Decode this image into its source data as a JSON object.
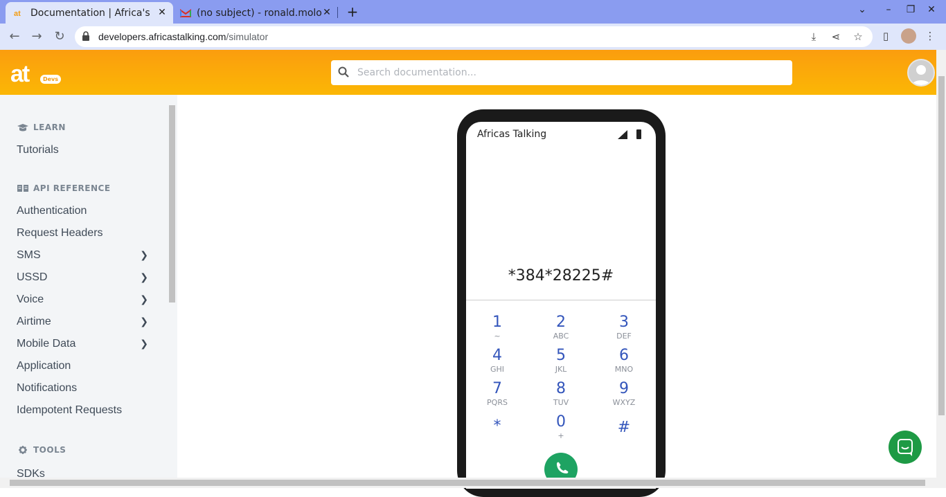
{
  "browser": {
    "tabs": [
      {
        "title": "Documentation | Africa's",
        "icon": "at-favicon"
      },
      {
        "title": "(no subject) - ronald.molo",
        "icon": "gmail-favicon"
      }
    ],
    "new_tab": "+",
    "url_host": "developers.africastalking.com",
    "url_path": "/simulator"
  },
  "header": {
    "logo": "at",
    "logo_badge": "Devs",
    "search_placeholder": "Search documentation..."
  },
  "sidebar": {
    "learn_label": "LEARN",
    "learn_items": [
      "Tutorials"
    ],
    "api_label": "API REFERENCE",
    "api_items": [
      {
        "label": "Authentication",
        "expandable": false
      },
      {
        "label": "Request Headers",
        "expandable": false
      },
      {
        "label": "SMS",
        "expandable": true
      },
      {
        "label": "USSD",
        "expandable": true
      },
      {
        "label": "Voice",
        "expandable": true
      },
      {
        "label": "Airtime",
        "expandable": true
      },
      {
        "label": "Mobile Data",
        "expandable": true
      },
      {
        "label": "Application",
        "expandable": false
      },
      {
        "label": "Notifications",
        "expandable": false
      },
      {
        "label": "Idempotent Requests",
        "expandable": false
      }
    ],
    "tools_label": "TOOLS",
    "tools_items": [
      "SDKs"
    ]
  },
  "phone": {
    "carrier": "Africas Talking",
    "dialed": "*384*28225#",
    "keys": [
      {
        "digit": "1",
        "letters": "~"
      },
      {
        "digit": "2",
        "letters": "ABC"
      },
      {
        "digit": "3",
        "letters": "DEF"
      },
      {
        "digit": "4",
        "letters": "GHI"
      },
      {
        "digit": "5",
        "letters": "JKL"
      },
      {
        "digit": "6",
        "letters": "MNO"
      },
      {
        "digit": "7",
        "letters": "PQRS"
      },
      {
        "digit": "8",
        "letters": "TUV"
      },
      {
        "digit": "9",
        "letters": "WXYZ"
      },
      {
        "digit": "*",
        "letters": ""
      },
      {
        "digit": "0",
        "letters": "+"
      },
      {
        "digit": "#",
        "letters": ""
      }
    ]
  },
  "colors": {
    "header_orange": "#fbb705",
    "keypad_blue": "#3355bb",
    "call_green": "#1ea362",
    "chat_green": "#1e9a45"
  }
}
